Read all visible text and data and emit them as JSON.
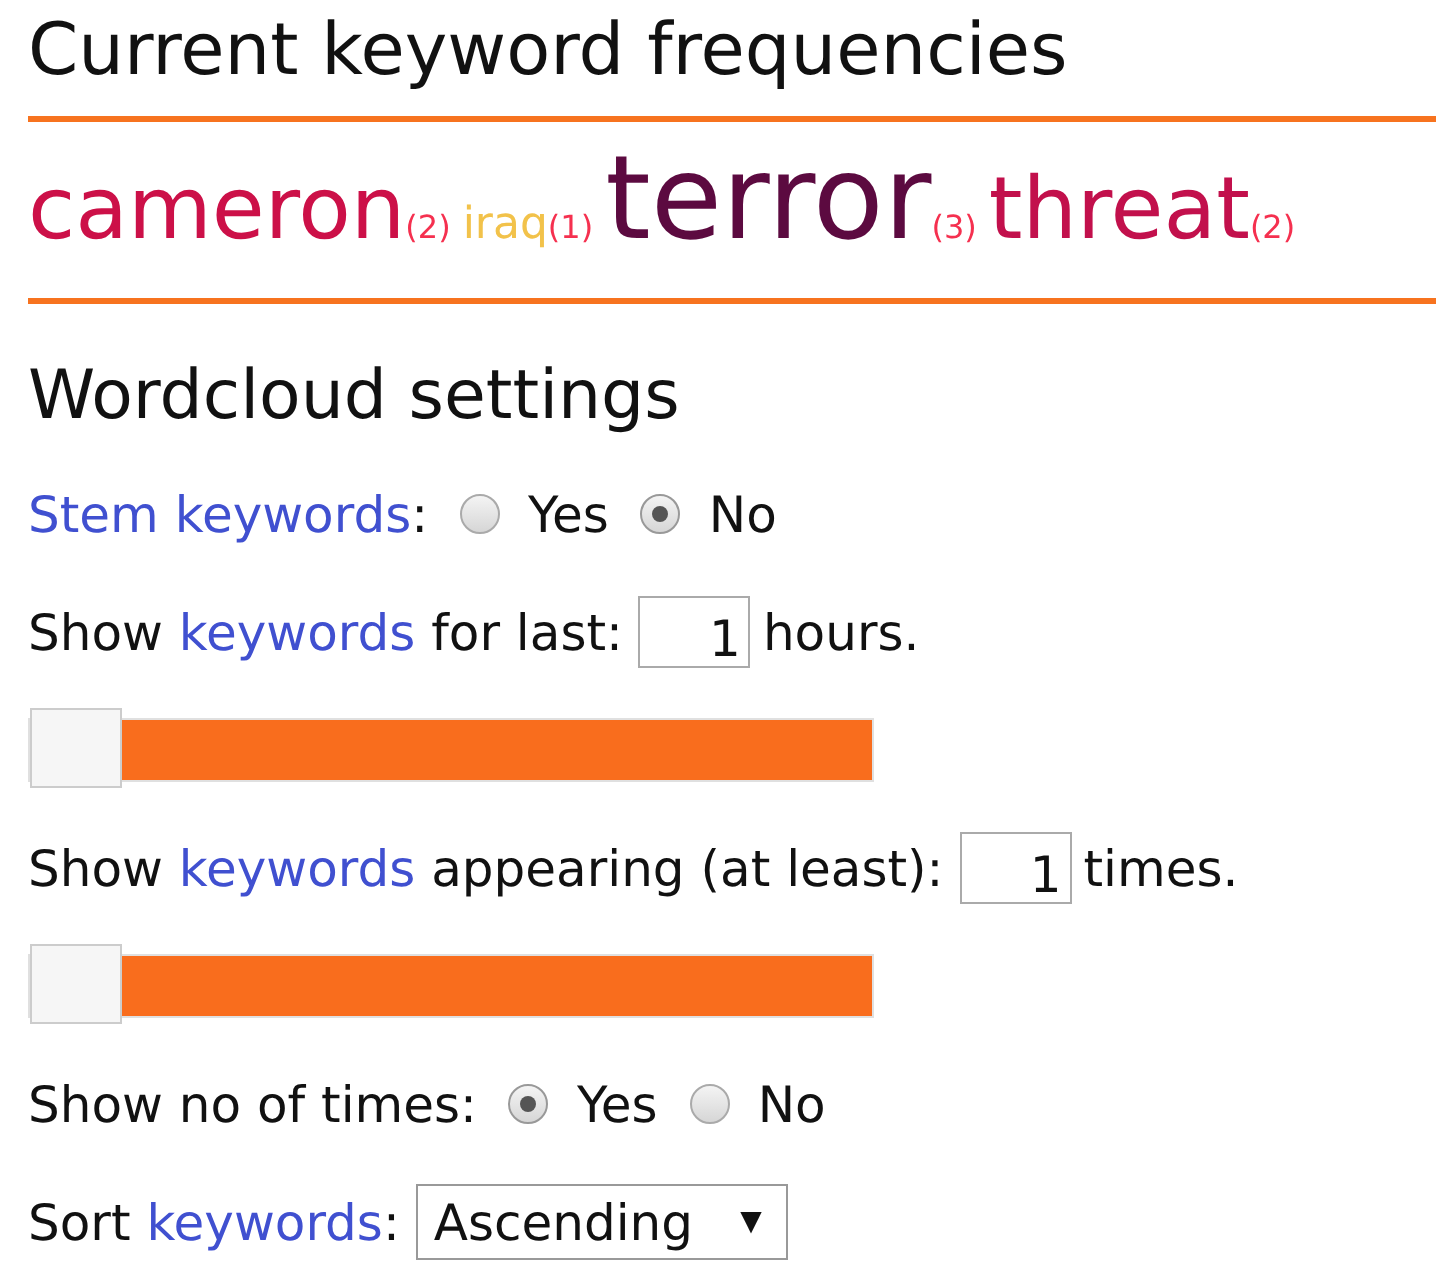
{
  "cloud_title": "Current keyword frequencies",
  "keywords": [
    {
      "word": "cameron",
      "count": "(2)",
      "color": "#cc1048"
    },
    {
      "word": "iraq",
      "count": "(1)",
      "color": "#f2c24a"
    },
    {
      "word": "terror",
      "count": "(3)",
      "color": "#5c0a40"
    },
    {
      "word": "threat",
      "count": "(2)",
      "color": "#c2104c"
    }
  ],
  "settings_title": "Wordcloud settings",
  "settings": [
    {
      "kind": "radio",
      "label": [
        {
          "text": "Stem keywords",
          "link": true
        },
        {
          "text": ":",
          "link": false
        }
      ],
      "options": [
        {
          "label": "Yes",
          "selected": false
        },
        {
          "label": "No",
          "selected": true
        }
      ]
    },
    {
      "kind": "number",
      "label": [
        {
          "text": "Show ",
          "link": false
        },
        {
          "text": "keywords",
          "link": true
        },
        {
          "text": " for last:",
          "link": false
        }
      ],
      "value": "1",
      "unit": "hours."
    },
    {
      "kind": "slider",
      "level": 0
    },
    {
      "kind": "number",
      "label": [
        {
          "text": "Show ",
          "link": false
        },
        {
          "text": "keywords",
          "link": true
        },
        {
          "text": " appearing (at least):",
          "link": false
        }
      ],
      "value": "1",
      "unit": "times."
    },
    {
      "kind": "slider",
      "level": 0
    },
    {
      "kind": "radio",
      "label": [
        {
          "text": "Show no of times:",
          "link": false
        }
      ],
      "options": [
        {
          "label": "Yes",
          "selected": true
        },
        {
          "label": "No",
          "selected": false
        }
      ]
    },
    {
      "kind": "select",
      "label": [
        {
          "text": "Sort ",
          "link": false
        },
        {
          "text": "keywords",
          "link": true
        },
        {
          "text": ":",
          "link": false
        }
      ],
      "value": "Ascending",
      "arrow": "▼"
    }
  ]
}
